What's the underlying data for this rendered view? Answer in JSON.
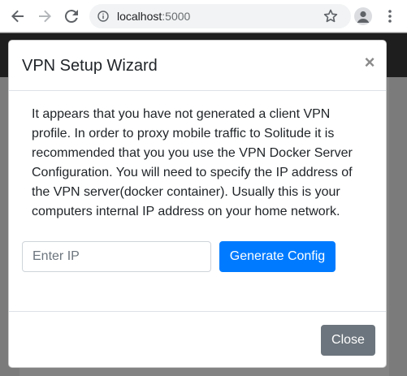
{
  "browser": {
    "url_host": "localhost",
    "url_port": ":5000",
    "icons": {
      "back": "back-arrow-icon",
      "forward": "forward-arrow-icon",
      "reload": "reload-icon",
      "info": "info-icon",
      "bookmark": "star-icon",
      "profile": "avatar-icon",
      "menu": "kebab-menu-icon"
    }
  },
  "modal": {
    "title": "VPN Setup Wizard",
    "close_symbol": "×",
    "message": "It appears that you have not generated a client VPN profile. In order to proxy mobile traffic to Solitude it is recommended that you you use the VPN Docker Server Configuration. You will need to specify the IP address of the VPN server(docker container). Usually this is your computers internal IP address on your home network.",
    "ip_input": {
      "placeholder": "Enter IP",
      "value": ""
    },
    "generate_button": "Generate Config",
    "close_button": "Close"
  },
  "colors": {
    "primary": "#007bff",
    "secondary": "#6c757d",
    "backdrop": "#7f7f7f"
  }
}
